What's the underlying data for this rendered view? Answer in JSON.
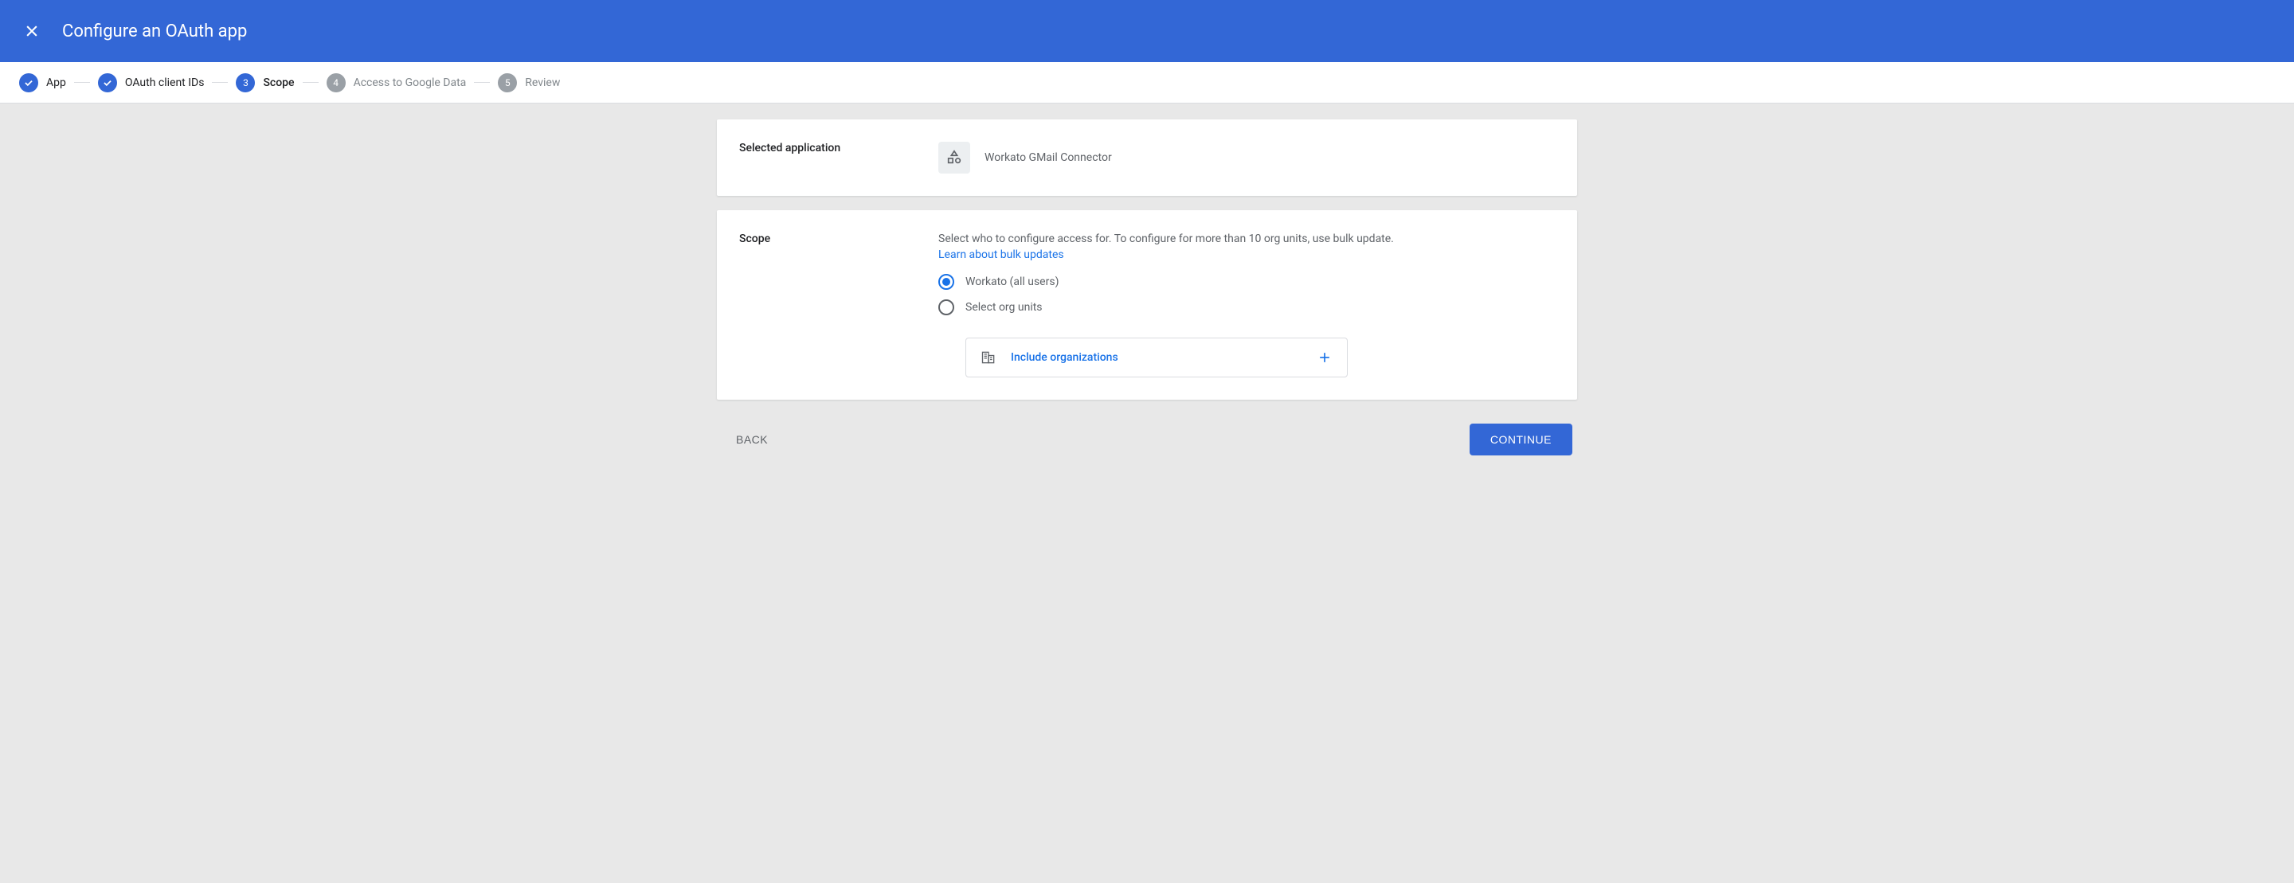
{
  "header": {
    "title": "Configure an OAuth app"
  },
  "stepper": {
    "steps": [
      {
        "label": "App",
        "state": "done"
      },
      {
        "label": "OAuth client IDs",
        "state": "done"
      },
      {
        "label": "Scope",
        "num": "3",
        "state": "current"
      },
      {
        "label": "Access to Google Data",
        "num": "4",
        "state": "pending"
      },
      {
        "label": "Review",
        "num": "5",
        "state": "pending"
      }
    ]
  },
  "selected_app": {
    "label": "Selected application",
    "name": "Workato GMail Connector"
  },
  "scope": {
    "label": "Scope",
    "description": "Select who to configure access for. To configure for more than 10 org units, use bulk update.",
    "link_text": "Learn about bulk updates",
    "radio_options": {
      "all_users": "Workato (all users)",
      "select_org": "Select org units"
    },
    "selected_radio": "all_users",
    "include_org_label": "Include organizations"
  },
  "actions": {
    "back": "Back",
    "continue": "Continue"
  }
}
